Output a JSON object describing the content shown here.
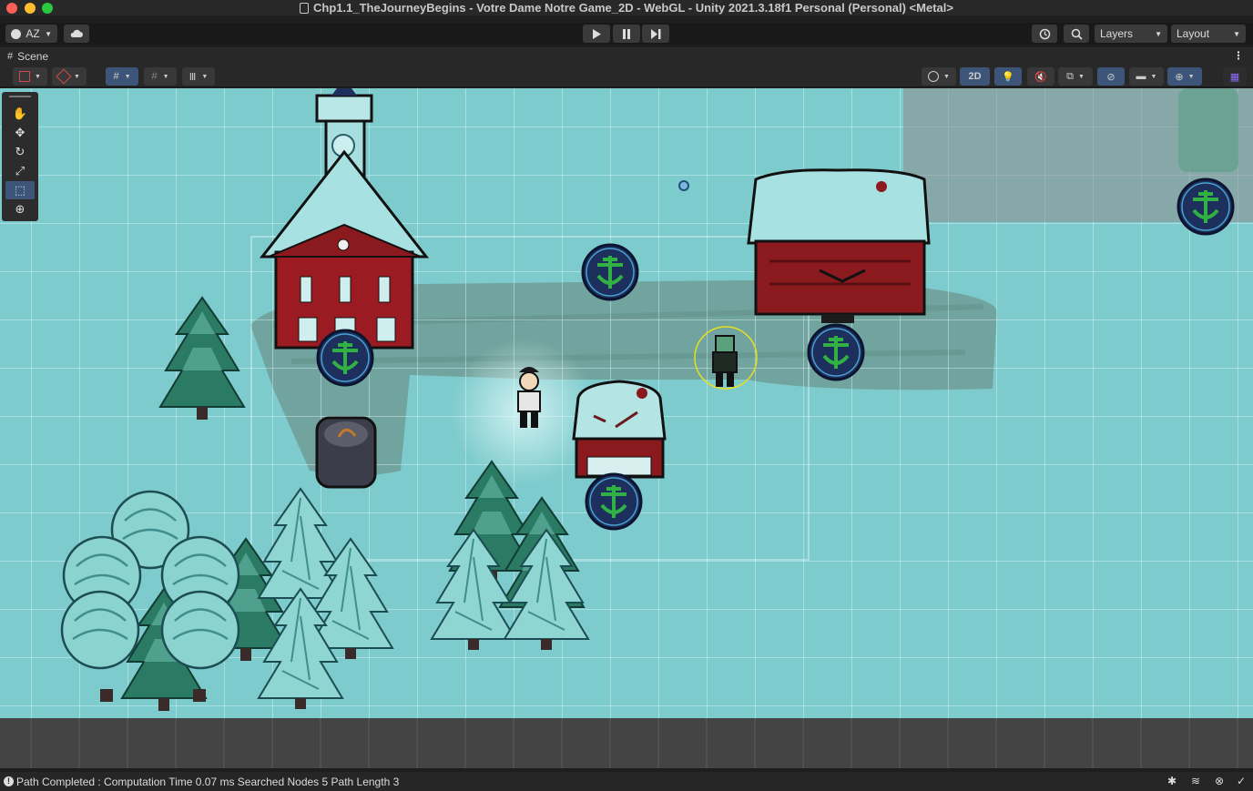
{
  "window": {
    "title": "Chp1.1_TheJourneyBegins - Votre Dame Notre Game_2D - WebGL - Unity 2021.3.18f1 Personal (Personal) <Metal>"
  },
  "toolbar": {
    "account_label": "AZ",
    "cloud_icon": "cloud-icon",
    "play_icon": "play-icon",
    "pause_icon": "pause-icon",
    "step_icon": "step-icon",
    "history_icon": "history-icon",
    "search_icon": "search-icon",
    "layers_label": "Layers",
    "layout_label": "Layout"
  },
  "scene_tab": {
    "label": "Scene",
    "mode_2d_label": "2D"
  },
  "tools": [
    "hand-tool",
    "move-tool",
    "rotate-tool",
    "scale-tool",
    "rect-tool",
    "transform-tool"
  ],
  "status": {
    "message": "Path Completed : Computation Time 0.07 ms Searched Nodes 5 Path Length 3"
  },
  "colors": {
    "snow": "#7ecbcd",
    "grid": "#d8f3f4",
    "barn_red": "#8b1a1e",
    "waypoint_blue": "#1d3a6b",
    "waypoint_green": "#2e9a3a"
  }
}
